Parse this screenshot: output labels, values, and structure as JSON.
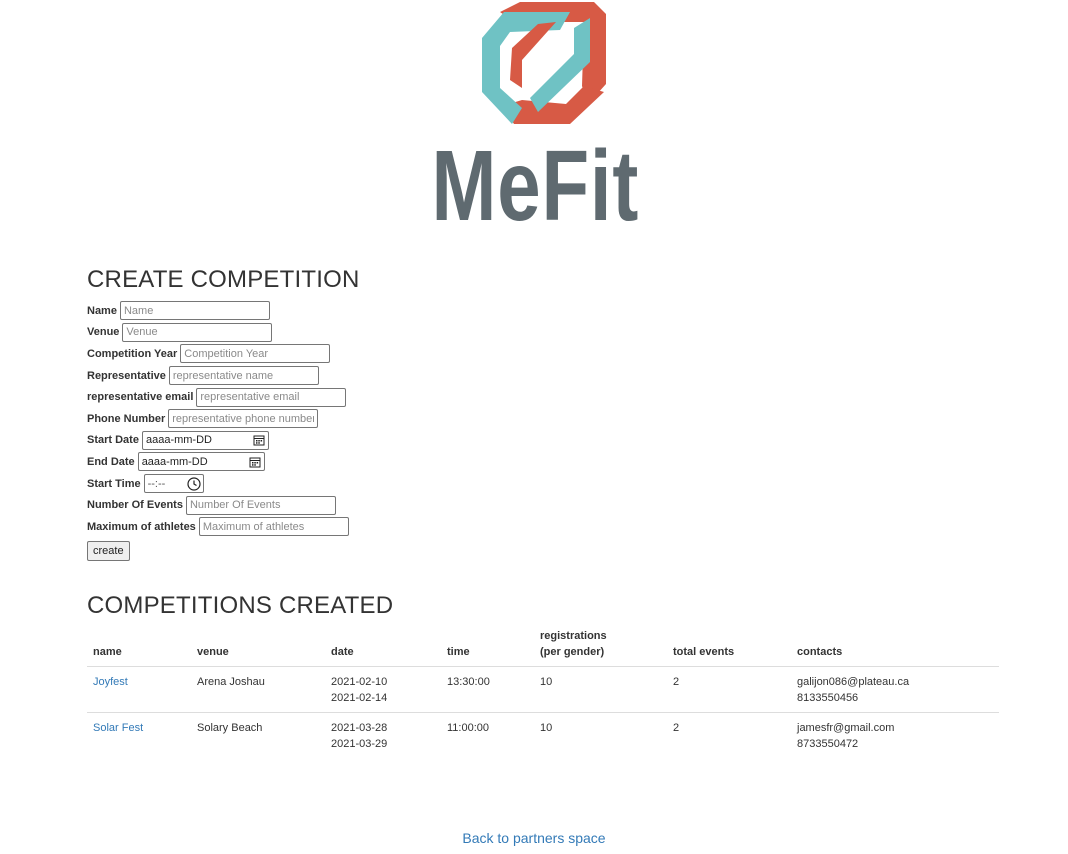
{
  "logo": {
    "text": "MeFit",
    "colors": {
      "red": "#d75a45",
      "teal": "#6fc2c4",
      "gray": "#5f6a70"
    }
  },
  "create_section": {
    "title": "CREATE COMPETITION",
    "fields": [
      {
        "label": "Name",
        "placeholder": "Name"
      },
      {
        "label": "Venue",
        "placeholder": "Venue"
      },
      {
        "label": "Competition Year",
        "placeholder": "Competition Year"
      },
      {
        "label": "Representative",
        "placeholder": "representative name"
      },
      {
        "label": "representative email",
        "placeholder": "representative email"
      },
      {
        "label": "Phone Number",
        "placeholder": "representative phone number"
      },
      {
        "label": "Start Date",
        "value": "aaaa-mm-DD",
        "icon": "calendar-icon"
      },
      {
        "label": "End Date",
        "value": "aaaa-mm-DD",
        "icon": "calendar-icon"
      },
      {
        "label": "Start Time",
        "value": "--:--",
        "icon": "clock-icon"
      },
      {
        "label": "Number Of Events",
        "placeholder": "Number Of Events"
      },
      {
        "label": "Maximum of athletes",
        "placeholder": "Maximum of athletes"
      }
    ],
    "create_label": "create"
  },
  "created_section": {
    "title": "COMPETITIONS CREATED",
    "columns": {
      "name": "name",
      "venue": "venue",
      "date": "date",
      "time": "time",
      "registrations_line1": "registrations",
      "registrations_line2": "(per gender)",
      "total_events": "total events",
      "contacts": "contacts"
    },
    "rows": [
      {
        "name": "Joyfest",
        "venue": "Arena Joshau",
        "date_start": "2021-02-10",
        "date_end": "2021-02-14",
        "time": "13:30:00",
        "registrations": "10",
        "total_events": "2",
        "email": "galijon086@plateau.ca",
        "phone": "8133550456"
      },
      {
        "name": "Solar Fest",
        "venue": "Solary Beach",
        "date_start": "2021-03-28",
        "date_end": "2021-03-29",
        "time": "11:00:00",
        "registrations": "10",
        "total_events": "2",
        "email": "jamesfr@gmail.com",
        "phone": "8733550472"
      }
    ]
  },
  "footer": {
    "back_link": "Back to partners space"
  }
}
